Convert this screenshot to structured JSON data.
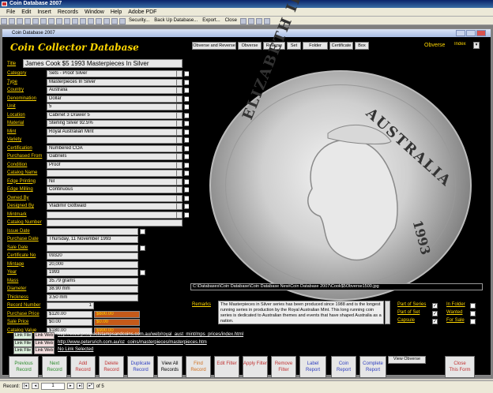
{
  "app": {
    "title": "Coin Database 2007",
    "menus": [
      "File",
      "Edit",
      "Insert",
      "Records",
      "Window",
      "Help",
      "Adobe PDF"
    ],
    "toolbar_text": [
      "Security...",
      "Back Up Database...",
      "Export...",
      "Close"
    ]
  },
  "form": {
    "window_title": "Coin Database 2007",
    "heading": "Coin Collector Database",
    "top_buttons": [
      "Obverse and Reverse",
      "Obverse",
      "Reverse",
      "Set",
      "Folder Cover",
      "Certificate",
      "Box"
    ],
    "view_label": "Obverse",
    "index_label": "Index",
    "title_label": "Title",
    "title_value": "James Cook $5 1993 Masterpieces In Silver"
  },
  "fields": [
    {
      "label": "Category",
      "value": "Sets - Proof Silver"
    },
    {
      "label": "Type",
      "value": "Masterpieces In Silver"
    },
    {
      "label": "Country",
      "value": "Australia"
    },
    {
      "label": "Denomination",
      "value": "Dollar"
    },
    {
      "label": "Unit",
      "value": "5"
    },
    {
      "label": "Location",
      "value": "Cabinet 3 Drawer 5"
    },
    {
      "label": "Material",
      "value": "Sterling Silver 92.5%"
    },
    {
      "label": "Mint",
      "value": "Royal Australian Mint"
    },
    {
      "label": "Variety",
      "value": ""
    },
    {
      "label": "Certification",
      "value": "Numbered COA"
    },
    {
      "label": "Purchased From",
      "value": "Gabriels"
    },
    {
      "label": "Condition",
      "value": "Proof"
    },
    {
      "label": "Catalog Name",
      "value": ""
    },
    {
      "label": "Edge Printing",
      "value": "Nil"
    },
    {
      "label": "Edge Milling",
      "value": "Continuous"
    },
    {
      "label": "Owned By",
      "value": ""
    },
    {
      "label": "Designed By",
      "value": "Vladimir Gottwald"
    },
    {
      "label": "Mintmark",
      "value": ""
    }
  ],
  "fields2": [
    {
      "label": "Catalog Number",
      "value": ""
    },
    {
      "label": "Issue Date",
      "value": ""
    },
    {
      "label": "Purchase Date",
      "value": "Thursday, 11 November 1993"
    },
    {
      "label": "Sale Date",
      "value": ""
    },
    {
      "label": "Certificate No",
      "value": "09320"
    },
    {
      "label": "Mintage",
      "value": "20,000"
    },
    {
      "label": "Year",
      "value": "1993"
    },
    {
      "label": "Mass",
      "value": "35.79 grams"
    },
    {
      "label": "Diameter",
      "value": "38.90 mm"
    },
    {
      "label": "Thickness",
      "value": "3.50 mm"
    }
  ],
  "record": {
    "label": "Record Number",
    "value": "1"
  },
  "prices": [
    {
      "label": "Purchase Price",
      "value": "$120.00",
      "value2": "$600.00"
    },
    {
      "label": "Sale Price",
      "value": "$0.00",
      "value2": "$0.00"
    },
    {
      "label": "Catalog Value",
      "value": "$180.00",
      "value2": "$900.00"
    }
  ],
  "coin": {
    "legend_left": "ELIZABETH II",
    "legend_right": "AUSTRALIA",
    "year": "1993"
  },
  "image_path": "C:\\Databases\\Coin Database\\Coin Database New\\Coin Database 2007\\Cook$5Obverse1500.jpg",
  "remarks": {
    "label": "Remarks",
    "text": "The Masterpieces in Silver series has been produced since 1988 and is the longest running series in production by the Royal Australian Mint. This long running coin series is dedicated to Australian themes and events that have shaped Australia as a nation."
  },
  "flags": [
    {
      "label": "Part of Series",
      "checked": "✓"
    },
    {
      "label": "Part of Set",
      "checked": "✓"
    },
    {
      "label": "Capsule",
      "checked": "✓"
    },
    {
      "label": "In Folder",
      "checked": ""
    },
    {
      "label": "Wanted",
      "checked": ""
    },
    {
      "label": "For Sale",
      "checked": ""
    }
  ],
  "links": [
    {
      "file": "Link File",
      "web": "Link Web",
      "url": "http://www.prospectstampsandcoins.com.au/web/royal_aust_mint/mps_prices/index.html"
    },
    {
      "file": "Link File",
      "web": "Link Web",
      "url": "http://www.petersrich.com.au/oz_coins/masterpieces/masterpieces.htm"
    },
    {
      "file": "Link File",
      "web": "Link Web",
      "url": "No Link Selected"
    }
  ],
  "view_obverse_button": "View Obverse",
  "nav_buttons": [
    {
      "l1": "Previous",
      "l2": "Record",
      "color": "#2a8a2a"
    },
    {
      "l1": "Next",
      "l2": "Record",
      "color": "#2a8a2a"
    },
    {
      "l1": "Add",
      "l2": "Record",
      "color": "#c03030"
    },
    {
      "l1": "Delete",
      "l2": "Record",
      "color": "#c03030"
    },
    {
      "l1": "Duplicate",
      "l2": "Record",
      "color": "#3040c0"
    },
    {
      "l1": "View All",
      "l2": "Records",
      "color": "#000000"
    },
    {
      "l1": "Find",
      "l2": "Record",
      "color": "#d07020"
    },
    {
      "l1": "Edit Filter",
      "l2": "",
      "color": "#c03030"
    },
    {
      "l1": "Apply Filter",
      "l2": "",
      "color": "#c03030"
    },
    {
      "l1": "Remove",
      "l2": "Filter",
      "color": "#c03030"
    },
    {
      "l1": "Label",
      "l2": "Report",
      "color": "#3040c0"
    },
    {
      "l1": "Coin",
      "l2": "Report",
      "color": "#3040c0"
    },
    {
      "l1": "Complete",
      "l2": "Report",
      "color": "#3040c0"
    },
    {
      "l1": "Close",
      "l2": "This Form",
      "color": "#c03030"
    }
  ],
  "status": {
    "record_label": "Record:",
    "current": "1",
    "of": "of 5"
  }
}
